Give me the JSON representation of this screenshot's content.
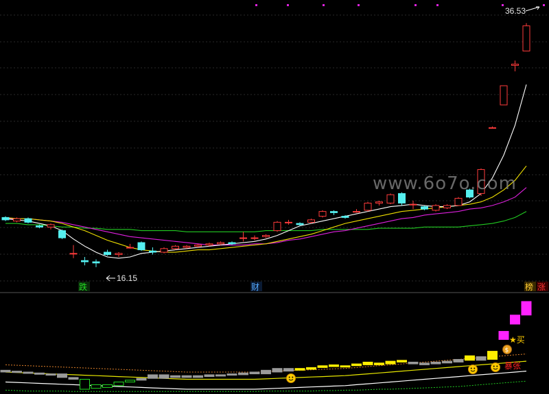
{
  "chart_data": [
    {
      "type": "candlestick",
      "annotations": {
        "high_value": "36.53",
        "low_value": "16.15",
        "label_fall": "跌",
        "label_finance": "财",
        "label_rank": "榜",
        "label_rise": "涨"
      },
      "ylim": [
        15,
        38
      ],
      "colors": {
        "up": "#ff3b3b",
        "down": "#55f0f0",
        "ma5": "#ffffff",
        "ma10": "#f0e000",
        "ma20": "#e020e0",
        "ma60": "#22cc22"
      },
      "candles": [
        [
          20.3,
          20.1,
          20.4,
          20.0
        ],
        [
          20.0,
          20.2,
          20.3,
          19.9
        ],
        [
          20.2,
          19.9,
          20.3,
          19.8
        ],
        [
          19.6,
          19.5,
          19.7,
          19.4
        ],
        [
          19.5,
          19.7,
          19.8,
          19.3
        ],
        [
          19.2,
          18.6,
          19.3,
          18.5
        ],
        [
          17.3,
          17.3,
          18.0,
          16.9
        ],
        [
          16.7,
          16.6,
          17.0,
          16.3
        ],
        [
          16.6,
          16.5,
          16.8,
          16.15
        ],
        [
          17.4,
          17.2,
          17.6,
          17.1
        ],
        [
          17.2,
          17.3,
          17.4,
          17.0
        ],
        [
          17.8,
          17.8,
          18.1,
          17.7
        ],
        [
          18.2,
          17.6,
          18.3,
          17.5
        ],
        [
          17.5,
          17.4,
          17.8,
          17.2
        ],
        [
          17.4,
          17.7,
          17.8,
          17.3
        ],
        [
          17.7,
          17.9,
          18.0,
          17.6
        ],
        [
          17.8,
          17.9,
          18.0,
          17.7
        ],
        [
          17.9,
          18.0,
          18.1,
          17.8
        ],
        [
          18.0,
          18.1,
          18.2,
          17.9
        ],
        [
          18.1,
          18.2,
          18.3,
          18.0
        ],
        [
          18.2,
          18.1,
          18.3,
          18.0
        ],
        [
          18.6,
          18.6,
          19.1,
          18.3
        ],
        [
          18.6,
          18.6,
          18.8,
          18.4
        ],
        [
          18.7,
          18.8,
          18.9,
          18.6
        ],
        [
          19.2,
          19.9,
          20.0,
          19.1
        ],
        [
          19.9,
          19.9,
          20.1,
          19.7
        ],
        [
          19.8,
          19.7,
          19.9,
          19.6
        ],
        [
          19.9,
          20.1,
          20.2,
          19.8
        ],
        [
          20.4,
          20.8,
          20.9,
          20.3
        ],
        [
          20.8,
          20.7,
          20.9,
          20.5
        ],
        [
          20.4,
          20.3,
          20.5,
          20.2
        ],
        [
          20.8,
          20.8,
          21.0,
          20.7
        ],
        [
          20.9,
          21.5,
          21.6,
          20.8
        ],
        [
          21.5,
          21.6,
          21.7,
          21.3
        ],
        [
          21.5,
          22.2,
          22.3,
          21.4
        ],
        [
          22.3,
          21.5,
          22.4,
          21.3
        ],
        [
          21.4,
          21.4,
          21.7,
          21.0
        ],
        [
          21.2,
          21.0,
          21.3,
          20.9
        ],
        [
          20.9,
          21.3,
          21.4,
          20.8
        ],
        [
          21.1,
          21.3,
          21.4,
          21.0
        ],
        [
          21.3,
          21.9,
          22.0,
          21.3
        ],
        [
          22.6,
          22.0,
          22.7,
          21.9
        ],
        [
          22.3,
          24.3,
          24.4,
          22.1
        ],
        [
          27.8,
          27.8,
          27.9,
          27.8
        ],
        [
          29.7,
          31.3,
          31.3,
          29.7
        ],
        [
          33.0,
          33.1,
          33.4,
          32.5
        ],
        [
          34.2,
          36.3,
          36.53,
          34.2
        ]
      ],
      "ma5": [
        20.2,
        20.1,
        20.0,
        19.8,
        19.6,
        19.2,
        18.5,
        17.9,
        17.4,
        17.0,
        16.9,
        17.0,
        17.3,
        17.4,
        17.5,
        17.6,
        17.7,
        17.8,
        17.9,
        18.0,
        18.1,
        18.2,
        18.3,
        18.5,
        18.8,
        19.2,
        19.6,
        19.8,
        20.0,
        20.2,
        20.4,
        20.6,
        20.8,
        21.0,
        21.2,
        21.3,
        21.4,
        21.3,
        21.2,
        21.2,
        21.3,
        21.6,
        22.3,
        23.6,
        25.5,
        28.0,
        31.4
      ],
      "ma10": [
        20.3,
        20.2,
        20.2,
        20.1,
        20.0,
        19.8,
        19.5,
        19.2,
        18.8,
        18.4,
        18.1,
        17.8,
        17.6,
        17.5,
        17.4,
        17.4,
        17.5,
        17.6,
        17.6,
        17.7,
        17.8,
        17.9,
        18.0,
        18.1,
        18.3,
        18.5,
        18.7,
        18.9,
        19.2,
        19.5,
        19.8,
        20.0,
        20.2,
        20.4,
        20.6,
        20.8,
        20.9,
        21.0,
        21.1,
        21.2,
        21.3,
        21.4,
        21.6,
        22.0,
        22.6,
        23.4,
        24.6
      ],
      "ma20": [
        20.2,
        20.2,
        20.2,
        20.1,
        20.0,
        19.9,
        19.7,
        19.5,
        19.3,
        19.1,
        18.9,
        18.7,
        18.6,
        18.5,
        18.4,
        18.3,
        18.2,
        18.1,
        18.0,
        18.0,
        18.0,
        18.0,
        18.1,
        18.1,
        18.2,
        18.4,
        18.5,
        18.7,
        18.9,
        19.1,
        19.2,
        19.4,
        19.6,
        19.8,
        20.0,
        20.2,
        20.3,
        20.5,
        20.6,
        20.7,
        20.8,
        21.0,
        21.1,
        21.3,
        21.6,
        22.0,
        22.8
      ],
      "ma60": [
        19.8,
        19.8,
        19.7,
        19.7,
        19.6,
        19.5,
        19.5,
        19.4,
        19.4,
        19.3,
        19.3,
        19.3,
        19.2,
        19.2,
        19.2,
        19.2,
        19.1,
        19.1,
        19.1,
        19.1,
        19.1,
        19.1,
        19.1,
        19.2,
        19.2,
        19.2,
        19.2,
        19.2,
        19.3,
        19.3,
        19.3,
        19.3,
        19.3,
        19.4,
        19.4,
        19.4,
        19.4,
        19.5,
        19.5,
        19.5,
        19.5,
        19.6,
        19.7,
        19.8,
        20.0,
        20.3,
        20.8
      ]
    },
    {
      "type": "indicator",
      "annotations": {
        "baozhang": "暴张",
        "mai": "★买"
      },
      "ylim": [
        0,
        100
      ],
      "bands": {
        "upper": [
          30,
          29.5,
          29,
          28.5,
          28,
          27.5,
          27,
          26.5,
          26,
          25.5,
          25,
          24.5,
          24,
          23.5,
          23,
          22.5,
          22,
          22,
          22,
          22,
          22,
          22,
          22,
          22.5,
          23,
          23.5,
          24,
          24.5,
          25,
          25.5,
          26,
          27,
          28,
          29,
          30,
          31,
          32,
          33,
          34,
          35,
          36,
          37,
          38,
          39,
          40,
          41,
          42
        ],
        "middle": [
          22,
          21.5,
          21,
          20.5,
          20,
          19.5,
          19,
          18.5,
          18,
          17.5,
          17,
          16.5,
          16,
          15.5,
          15,
          14.5,
          14,
          14,
          14,
          14,
          14,
          14,
          14,
          14.5,
          15,
          15.5,
          16,
          16.5,
          17,
          17.5,
          18,
          19,
          20,
          21,
          22,
          23,
          24,
          25,
          26,
          27,
          28,
          29,
          30,
          31,
          32,
          33,
          34
        ],
        "lower": [
          11,
          10.5,
          10,
          9.5,
          9,
          8.5,
          8,
          7.5,
          7,
          6.5,
          6,
          5.5,
          5,
          4.5,
          4,
          3.5,
          3,
          3,
          3,
          3,
          3,
          3,
          3,
          3.5,
          4,
          4.5,
          5,
          5.5,
          6,
          6.5,
          7,
          8,
          9,
          10,
          11,
          12,
          13,
          14,
          15,
          16,
          17,
          18,
          19,
          20,
          21,
          22,
          23
        ],
        "lowest": [
          2,
          1.5,
          1,
          1,
          1,
          1,
          0.5,
          0.5,
          0.5,
          0.5,
          0.5,
          0.5,
          0.5,
          0.5,
          0.5,
          0.5,
          0.5,
          0.5,
          0.5,
          0.5,
          0.5,
          0.5,
          0.5,
          1,
          1,
          1,
          1,
          1,
          1.5,
          1.5,
          2,
          2,
          2.5,
          3,
          3,
          3.5,
          4,
          4.5,
          5,
          5.5,
          6,
          7,
          8,
          9,
          10,
          11,
          12
        ]
      },
      "bars": [
        [
          22,
          24,
          "gray"
        ],
        [
          22,
          23,
          "gray"
        ],
        [
          21,
          22,
          "gray"
        ],
        [
          20,
          21,
          "gray"
        ],
        [
          19,
          20,
          "gray"
        ],
        [
          16,
          20,
          "gray"
        ],
        [
          14,
          16,
          "gray"
        ],
        [
          3,
          14,
          "green"
        ],
        [
          4,
          8,
          "green"
        ],
        [
          5,
          8,
          "green"
        ],
        [
          7,
          11,
          "green"
        ],
        [
          11,
          13,
          "green"
        ],
        [
          13,
          15,
          "gray"
        ],
        [
          15,
          19,
          "gray"
        ],
        [
          15,
          19,
          "gray"
        ],
        [
          16,
          18,
          "gray"
        ],
        [
          16,
          18,
          "gray"
        ],
        [
          16,
          18,
          "gray"
        ],
        [
          17,
          19,
          "gray"
        ],
        [
          18,
          19,
          "gray"
        ],
        [
          19,
          20,
          "gray"
        ],
        [
          19,
          21,
          "gray"
        ],
        [
          20,
          22,
          "gray"
        ],
        [
          20,
          24,
          "gray"
        ],
        [
          22,
          26,
          "gray"
        ],
        [
          23,
          26,
          "gray"
        ],
        [
          24,
          26,
          "yellow"
        ],
        [
          25,
          27,
          "yellow"
        ],
        [
          27,
          29,
          "yellow"
        ],
        [
          28,
          30,
          "yellow"
        ],
        [
          28,
          29,
          "yellow"
        ],
        [
          29,
          31,
          "yellow"
        ],
        [
          30,
          33,
          "yellow"
        ],
        [
          30,
          32,
          "yellow"
        ],
        [
          31,
          34,
          "yellow"
        ],
        [
          33,
          35,
          "yellow"
        ],
        [
          31,
          33,
          "gray"
        ],
        [
          30,
          32,
          "gray"
        ],
        [
          31,
          33,
          "gray"
        ],
        [
          32,
          34,
          "gray"
        ],
        [
          33,
          36,
          "gray"
        ],
        [
          35,
          40,
          "yellow"
        ],
        [
          35,
          39,
          "gray"
        ],
        [
          36,
          45,
          "yellow"
        ],
        [
          58,
          67,
          "magenta"
        ],
        [
          75,
          85,
          "magenta"
        ],
        [
          85,
          100,
          "magenta"
        ]
      ]
    }
  ]
}
